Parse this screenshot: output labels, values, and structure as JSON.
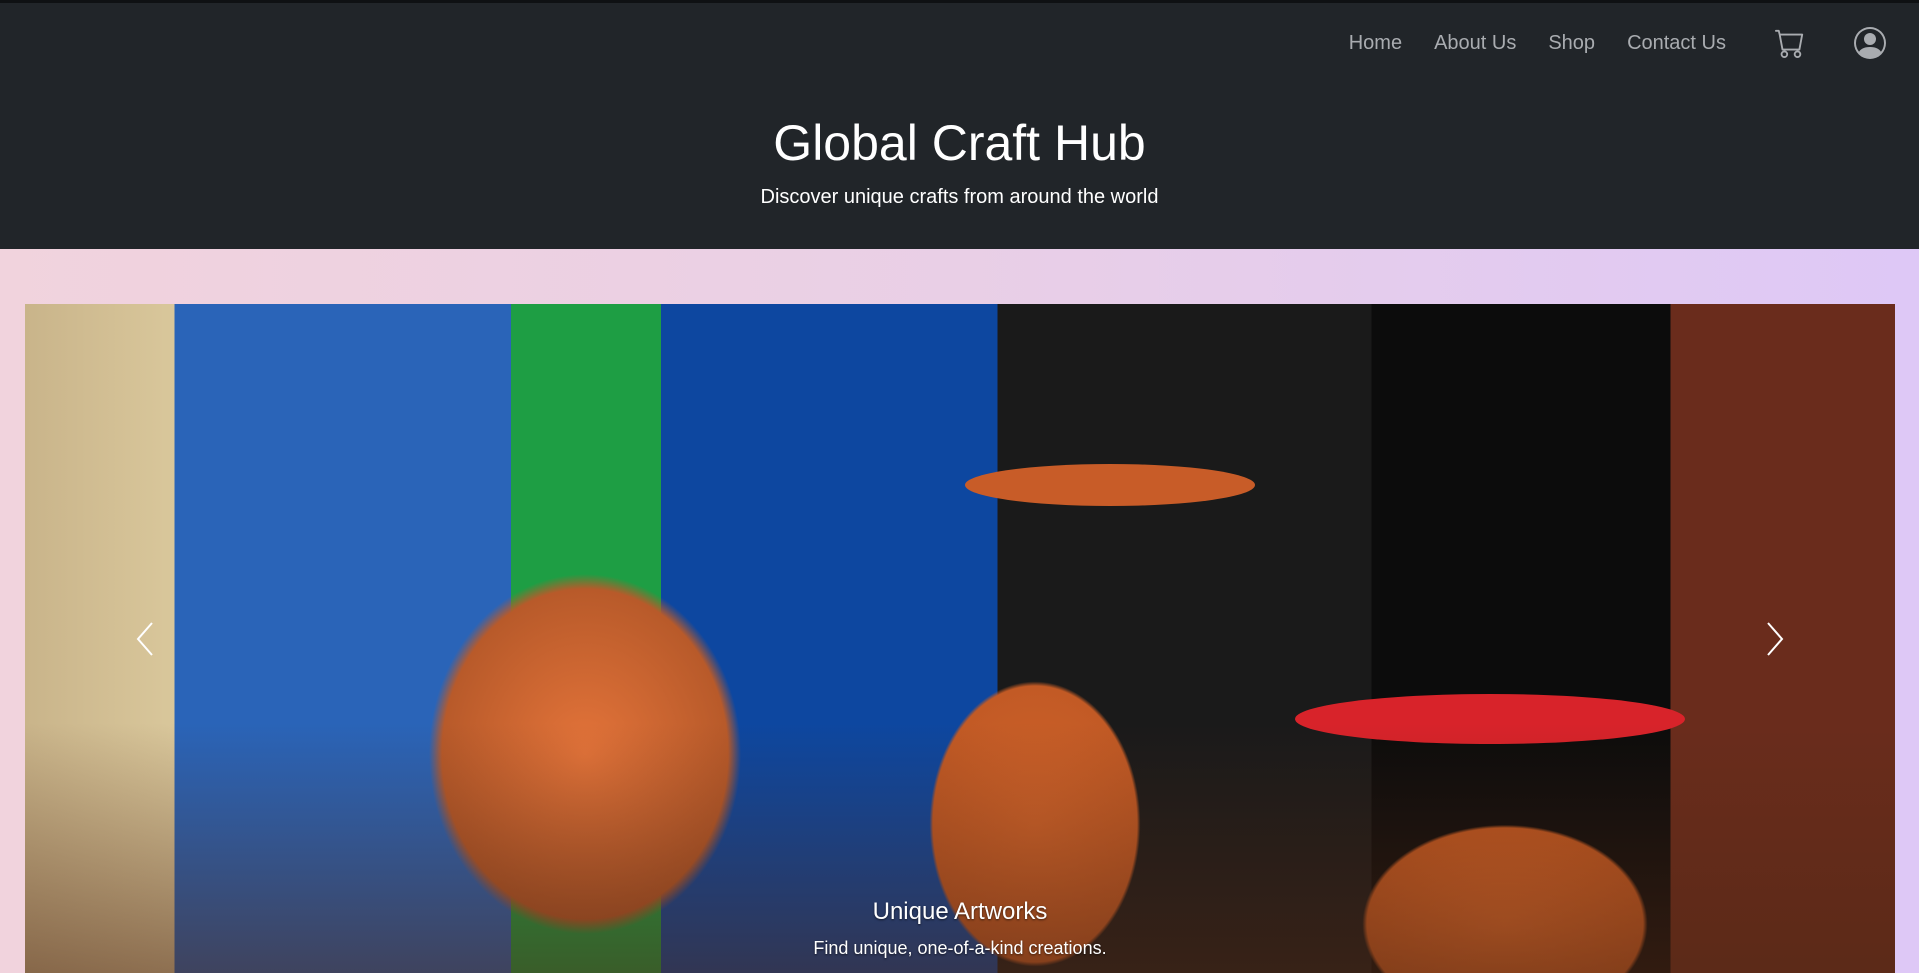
{
  "nav": {
    "links": [
      "Home",
      "About Us",
      "Shop",
      "Contact Us"
    ],
    "cart_icon": "cart-icon",
    "account_icon": "user-circle-icon"
  },
  "brand": {
    "title": "Global Craft Hub",
    "tagline": "Discover unique crafts from around the world"
  },
  "carousel": {
    "slide": {
      "image": "artisan-painting-terracotta-pots",
      "caption_title": "Unique Artworks",
      "caption_text": "Find unique, one-of-a-kind creations."
    },
    "prev_icon": "chevron-left-icon",
    "next_icon": "chevron-right-icon"
  },
  "colors": {
    "header_bg": "#212529",
    "nav_link": "#a9acb0",
    "gradient_start": "#f1d3dd",
    "gradient_end": "#dec8f6"
  }
}
